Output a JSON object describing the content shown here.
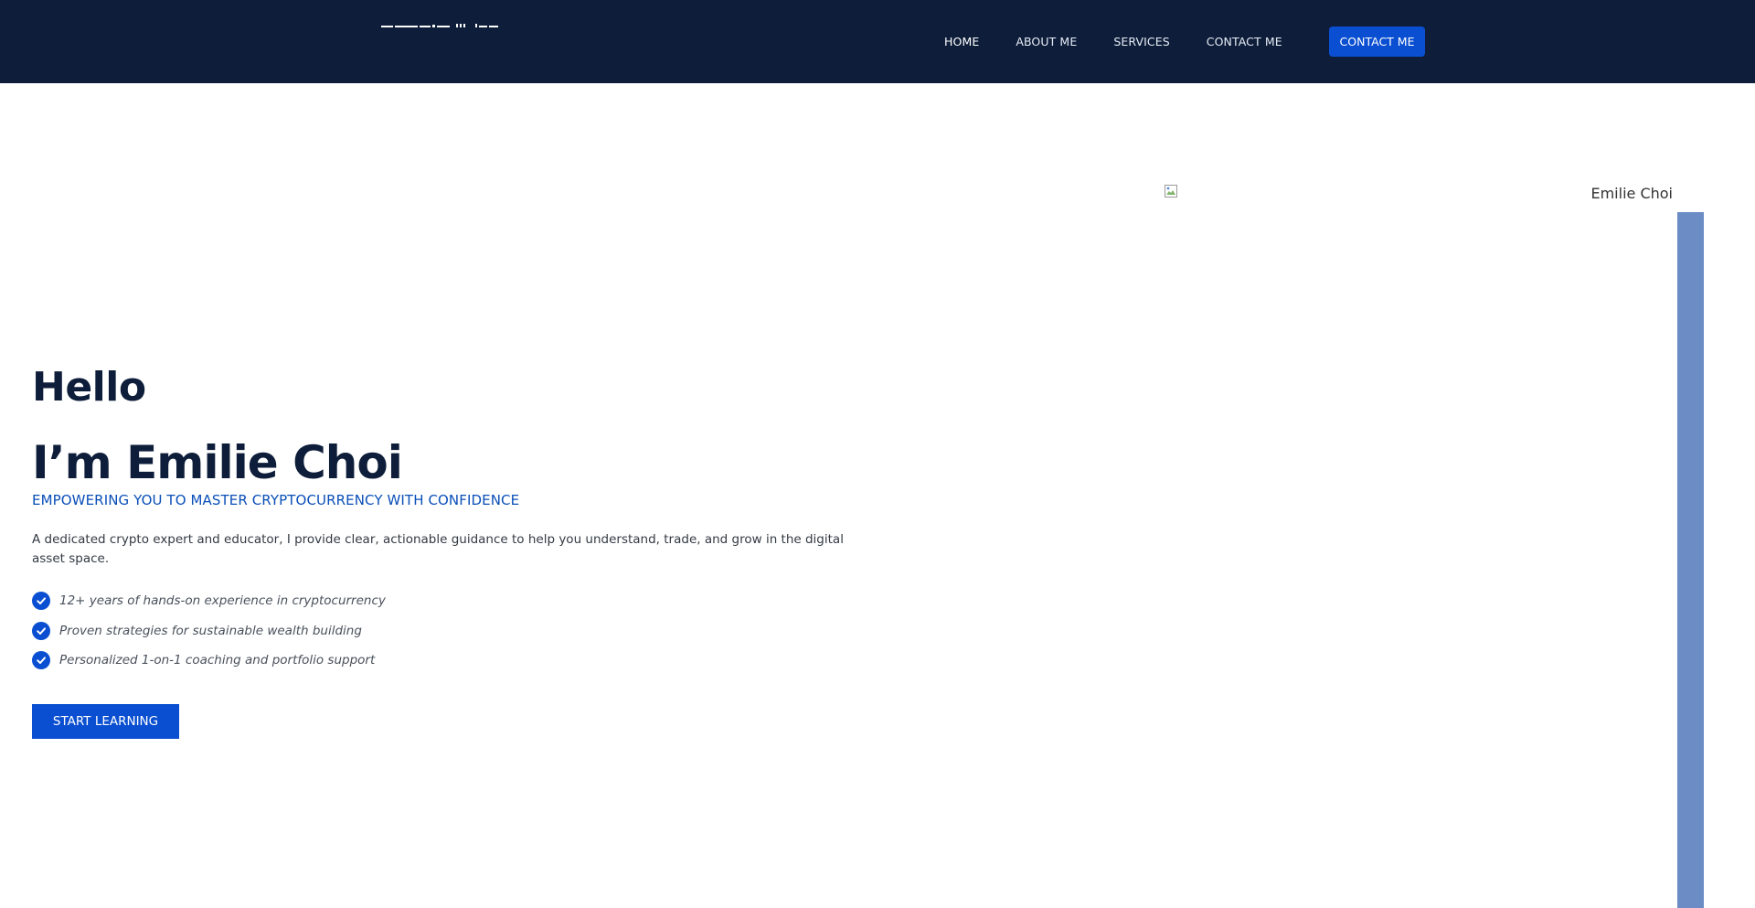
{
  "header": {
    "nav": [
      {
        "label": "HOME",
        "active": true
      },
      {
        "label": "ABOUT ME",
        "active": false
      },
      {
        "label": "SERVICES",
        "active": false
      },
      {
        "label": "CONTACT ME",
        "active": false
      }
    ],
    "cta_label": "CONTACT ME"
  },
  "hero": {
    "greeting": "Hello",
    "name_line": "I’m Emilie Choi",
    "subtitle": "EMPOWERING YOU TO MASTER CRYPTOCURRENCY WITH CONFIDENCE",
    "description": "A dedicated crypto expert and educator, I provide clear, actionable guidance to help you understand, trade, and grow in the digital asset space.",
    "features": [
      "12+ years of hands-on experience in cryptocurrency",
      "Proven strategies for sustainable wealth building",
      "Personalized 1-on-1 coaching and portfolio support"
    ],
    "button_label": "START LEARNING"
  },
  "portrait": {
    "alt_text": "Emilie Choi"
  },
  "colors": {
    "header_bg": "#0e1e3a",
    "accent": "#0a4fd1",
    "subtitle": "#0a4fb8",
    "side_bar": "#6b8cc4"
  },
  "icons": {
    "feature_bullet": "check-circle-icon",
    "portrait_placeholder": "broken-image-icon"
  }
}
